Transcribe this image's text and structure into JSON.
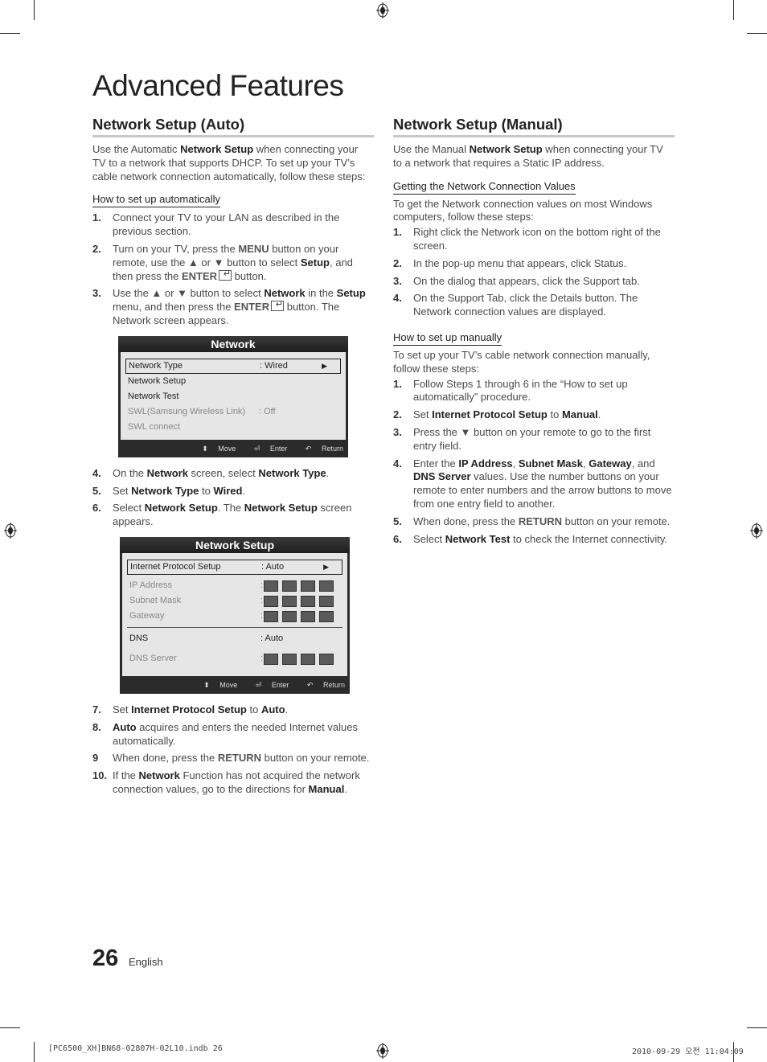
{
  "page_title": "Advanced Features",
  "auto": {
    "title": "Network Setup (Auto)",
    "intro_pre": "Use the Automatic ",
    "intro_bold": "Network Setup",
    "intro_post": " when connecting your TV to a network that supports DHCP. To set up your TV’s cable network connection automatically, follow these steps:",
    "subheading": "How to set up automatically",
    "steps_a": [
      {
        "num": "1.",
        "html": "Connect your TV to your LAN as described in the previous section."
      },
      {
        "num": "2.",
        "html": "Turn on your TV, press the <span class=\"sb\">MENU</span> button on your remote, use the ▲ or ▼ button to select <b>Setup</b>, and then press the <span class=\"sb\">ENTER</span><span class=\"enter-glyph\"></span> button."
      },
      {
        "num": "3.",
        "html": "Use the ▲ or ▼ button to select <b>Network</b> in the <b>Setup</b> menu, and then press the <span class=\"sb\">ENTER</span><span class=\"enter-glyph\"></span> button. The Network screen appears."
      }
    ],
    "steps_b": [
      {
        "num": "4.",
        "html": "On the <b>Network</b> screen, select <b>Network Type</b>."
      },
      {
        "num": "5.",
        "html": "Set <b>Network Type</b> to <b>Wired</b>."
      },
      {
        "num": "6.",
        "html": "Select <b>Network Setup</b>. The <b>Network Setup</b> screen appears."
      }
    ],
    "steps_c": [
      {
        "num": "7.",
        "html": "Set <b>Internet Protocol Setup</b> to <b>Auto</b>."
      },
      {
        "num": "8.",
        "html": "<b>Auto</b> acquires and enters the needed Internet values automatically."
      },
      {
        "num": "9",
        "html": "When done, press the <span class=\"sb\">RETURN</span> button on your remote."
      },
      {
        "num": "10.",
        "html": "If the <b>Network</b> Function has not acquired the network connection values, go to the directions for <b>Manual</b>."
      }
    ]
  },
  "network_osd": {
    "title": "Network",
    "rows": [
      {
        "label": "Network Type",
        "value": ": Wired",
        "arrow": "▶"
      },
      {
        "label": "Network Setup",
        "value": ""
      },
      {
        "label": "Network Test",
        "value": ""
      },
      {
        "label": "SWL(Samsung Wireless Link)",
        "value": ": Off"
      },
      {
        "label": "SWL connect",
        "value": ""
      }
    ],
    "footer": {
      "move": "Move",
      "enter": "Enter",
      "return": "Return"
    }
  },
  "setup_osd": {
    "title": "Network Setup",
    "rows": [
      {
        "label": "Internet Protocol Setup",
        "value": ": Auto",
        "arrow": "▶"
      },
      {
        "label": "IP Address",
        "value": ":"
      },
      {
        "label": "Subnet Mask",
        "value": ":"
      },
      {
        "label": "Gateway",
        "value": ":"
      },
      {
        "label": "DNS",
        "value": ": Auto"
      },
      {
        "label": "DNS Server",
        "value": ":"
      }
    ],
    "footer": {
      "move": "Move",
      "enter": "Enter",
      "return": "Return"
    }
  },
  "manual": {
    "title": "Network Setup (Manual)",
    "intro_pre": "Use the Manual ",
    "intro_bold": "Network Setup",
    "intro_post": " when connecting your TV to a network that requires a Static IP address.",
    "sub1": "Getting the Network Connection Values",
    "sub1_intro": "To get the Network connection values on most Windows computers, follow these steps:",
    "steps1": [
      {
        "num": "1.",
        "html": "Right click the Network icon on the bottom right of the screen."
      },
      {
        "num": "2.",
        "html": "In the pop-up menu that appears, click Status."
      },
      {
        "num": "3.",
        "html": "On the dialog that appears, click the Support tab."
      },
      {
        "num": "4.",
        "html": "On the Support Tab, click the Details button. The Network connection values are displayed."
      }
    ],
    "sub2": "How to set up manually",
    "sub2_intro": "To set up your TV’s cable network connection manually, follow these steps:",
    "steps2": [
      {
        "num": "1.",
        "html": "Follow Steps 1 through 6 in the “How to set up automatically” procedure."
      },
      {
        "num": "2.",
        "html": "Set <b>Internet Protocol Setup</b> to <b>Manual</b>."
      },
      {
        "num": "3.",
        "html": "Press the ▼ button on your remote to go to the first entry field."
      },
      {
        "num": "4.",
        "html": "Enter the <b>IP Address</b>, <b>Subnet Mask</b>, <b>Gateway</b>, and <b>DNS Server</b> values. Use the number buttons on your remote to enter numbers and the arrow buttons to move from one entry field to another."
      },
      {
        "num": "5.",
        "html": "When done, press the <span class=\"sb\">RETURN</span> button on your remote."
      },
      {
        "num": "6.",
        "html": "Select <b>Network Test</b> to check the Internet connectivity."
      }
    ]
  },
  "footer": {
    "page_number": "26",
    "language": "English",
    "file": "[PC6500_XH]BN68-02807H-02L10.indb   26",
    "date": "2010-09-29   오전 11:04:09"
  }
}
